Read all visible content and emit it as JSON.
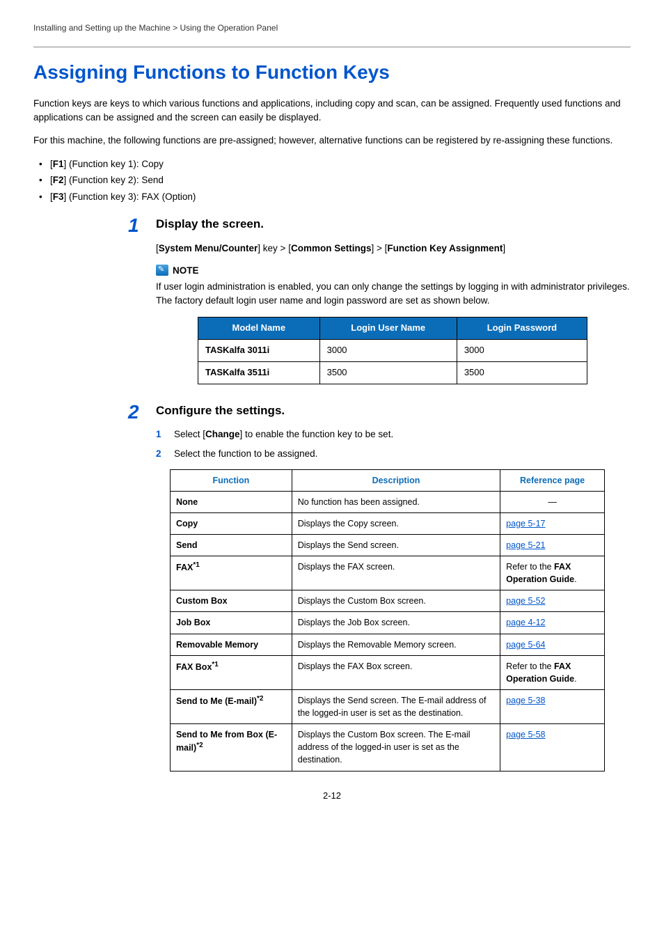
{
  "breadcrumb": "Installing and Setting up the Machine > Using the Operation Panel",
  "title": "Assigning Functions to Function Keys",
  "intro1": "Function keys are keys to which various functions and applications, including copy and scan, can be assigned. Frequently used functions and applications can be assigned and the screen can easily be displayed.",
  "intro2": "For this machine, the following functions are pre-assigned; however, alternative functions can be registered by re-assigning these functions.",
  "fk": {
    "f1_pre": "[",
    "f1_b": "F1",
    "f1_post": "] (Function key 1): Copy",
    "f2_pre": "[",
    "f2_b": "F2",
    "f2_post": "] (Function key 2): Send",
    "f3_pre": "[",
    "f3_b": "F3",
    "f3_post": "] (Function key 3): FAX (Option)"
  },
  "step1": {
    "num": "1",
    "title": "Display the screen.",
    "path_open1": "[",
    "path_b1": "System Menu/Counter",
    "path_mid1": "] key > [",
    "path_b2": "Common Settings",
    "path_mid2": "] > [",
    "path_b3": "Function Key Assignment",
    "path_close": "]",
    "note_label": "NOTE",
    "note_text": "If user login administration is enabled, you can only change the settings by logging in with administrator privileges. The factory default login user name and login password are set as shown below.",
    "table": {
      "h1": "Model Name",
      "h2": "Login User Name",
      "h3": "Login Password",
      "rows": [
        {
          "model": "TASKalfa 3011i",
          "user": "3000",
          "pass": "3000"
        },
        {
          "model": "TASKalfa 3511i",
          "user": "3500",
          "pass": "3500"
        }
      ]
    }
  },
  "step2": {
    "num": "2",
    "title": "Configure the settings.",
    "sub1_num": "1",
    "sub1_pre": "Select [",
    "sub1_b": "Change",
    "sub1_post": "] to enable the function key to be set.",
    "sub2_num": "2",
    "sub2_text": "Select the function to be assigned.",
    "table": {
      "h1": "Function",
      "h2": "Description",
      "h3": "Reference page",
      "rows": [
        {
          "fn": "None",
          "desc": "No function has been assigned.",
          "ref_type": "dash",
          "ref": "—"
        },
        {
          "fn": "Copy",
          "desc": "Displays the Copy screen.",
          "ref_type": "link",
          "ref": "page 5-17"
        },
        {
          "fn": "Send",
          "desc": "Displays the Send screen.",
          "ref_type": "link",
          "ref": "page 5-21"
        },
        {
          "fn_html": "FAX",
          "sup": "*1",
          "desc": "Displays the FAX screen.",
          "ref_type": "text",
          "ref_pre": "Refer to the ",
          "ref_b": "FAX Operation Guide",
          "ref_post": "."
        },
        {
          "fn": "Custom Box",
          "desc": "Displays the Custom Box screen.",
          "ref_type": "link",
          "ref": "page 5-52"
        },
        {
          "fn": "Job Box",
          "desc": "Displays the Job Box screen.",
          "ref_type": "link",
          "ref": "page 4-12"
        },
        {
          "fn": "Removable Memory",
          "desc": "Displays the Removable Memory screen.",
          "ref_type": "link",
          "ref": "page 5-64"
        },
        {
          "fn_html": "FAX Box",
          "sup": "*1",
          "desc": "Displays the FAX Box screen.",
          "ref_type": "text",
          "ref_pre": "Refer to the ",
          "ref_b": "FAX Operation Guide",
          "ref_post": "."
        },
        {
          "fn_html": "Send to Me (E-mail)",
          "sup": "*2",
          "desc": "Displays the Send screen. The E-mail address of the logged-in user is set as the destination.",
          "ref_type": "link",
          "ref": "page 5-38"
        },
        {
          "fn_html": "Send to Me from Box (E-mail)",
          "sup": "*2",
          "desc": "Displays the Custom Box screen. The E-mail address of the logged-in user is set as the destination.",
          "ref_type": "link",
          "ref": "page 5-58"
        }
      ]
    }
  },
  "page_number": "2-12"
}
